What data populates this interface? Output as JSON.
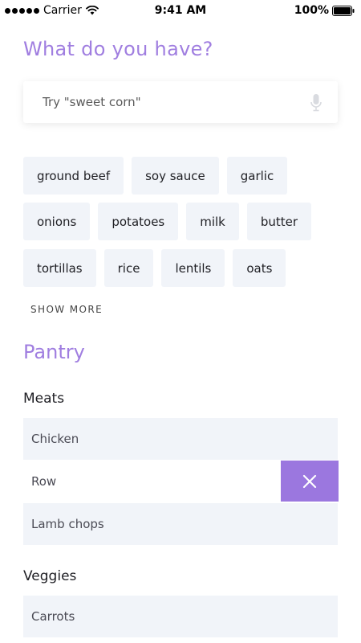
{
  "status_bar": {
    "carrier": "Carrier",
    "time": "9:41 AM",
    "battery": "100%"
  },
  "header": {
    "title": "What do you have?"
  },
  "search": {
    "placeholder": "Try \"sweet corn\"",
    "value": ""
  },
  "suggestions": {
    "rows": [
      [
        "ground beef",
        "soy sauce",
        "garlic"
      ],
      [
        "onions",
        "potatoes",
        "milk",
        "butter"
      ],
      [
        "tortillas",
        "rice",
        "lentils",
        "oats"
      ]
    ],
    "show_more_label": "SHOW MORE"
  },
  "pantry": {
    "title": "Pantry",
    "sections": [
      {
        "name": "Meats",
        "items": [
          "Chicken",
          "Row",
          "Lamb chops"
        ]
      },
      {
        "name": "Veggies",
        "items": [
          "Carrots"
        ]
      }
    ]
  },
  "colors": {
    "accent": "#a07ee0",
    "delete": "#9b77df",
    "chip_bg": "#f1f4f9"
  }
}
